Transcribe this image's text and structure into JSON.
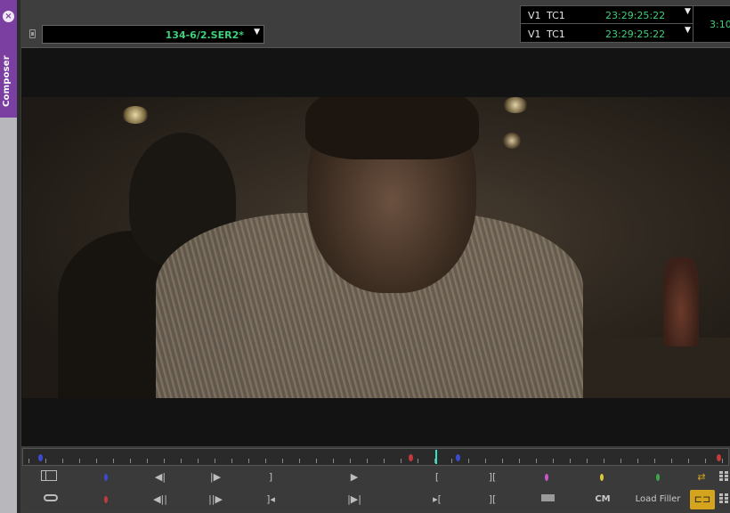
{
  "side_tab": {
    "label": "Composer",
    "close_icon": "close-icon"
  },
  "header": {
    "clip_name": "134-6/2.SER2*",
    "timecode_rows": [
      {
        "track": "V1",
        "type": "TC1",
        "value": "23:29:25:22"
      },
      {
        "track": "V1",
        "type": "TC1",
        "value": "23:29:25:22"
      }
    ],
    "extra_timecode": "3:10",
    "accent_color": "#3ed07a"
  },
  "position_bar": {
    "markers": [
      {
        "color": "#3c4ad0",
        "pos": 0.022
      },
      {
        "color": "#c43a3a",
        "pos": 0.55
      },
      {
        "color": "#3c4ad0",
        "pos": 0.616
      },
      {
        "color": "#c43a3a",
        "pos": 0.985
      }
    ],
    "playhead_color": "#2fe2c8"
  },
  "buttons_row1": {
    "items": [
      "bin-view-icon",
      "blue-marker-dot",
      "step-back-icon",
      "step-forward-icon",
      "mark-out-icon",
      "play-icon",
      "mark-in-icon",
      "mark-clip-icon",
      "pink-marker-dot",
      "yellow-marker-dot",
      "green-marker-dot",
      "sync-icon",
      "grid-icon"
    ]
  },
  "buttons_row2": {
    "cm_label": "CM",
    "load_filler_label": "Load Filler",
    "items": [
      "link-icon",
      "red-marker-dot",
      "fast-rewind-icon",
      "fast-forward-icon",
      "go-to-out-icon",
      "play-to-out-icon",
      "go-to-in-icon",
      "clear-marks-icon",
      "rect-icon",
      "cm-button",
      "load-filler-button",
      "splice-icon",
      "grid-icon"
    ]
  },
  "colors": {
    "purple_tab": "#7a3fa0",
    "highlight": "#d5a41f",
    "marker_blue": "#3c4ad0",
    "marker_red": "#c43a3a",
    "marker_pink": "#c85ac8",
    "marker_yellow": "#d8c83a",
    "marker_green": "#3aa84a"
  }
}
